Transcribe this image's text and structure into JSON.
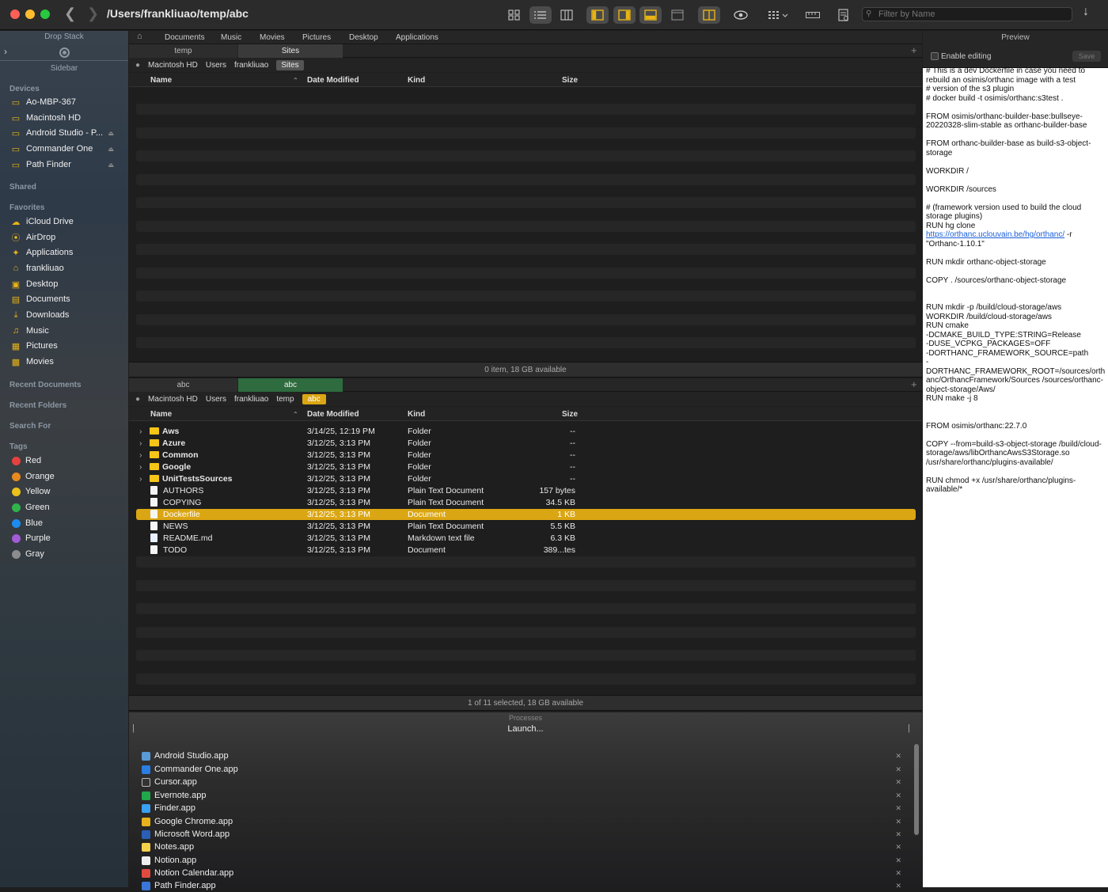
{
  "window": {
    "path": "/Users/frankliuao/temp/abc",
    "filter_placeholder": "Filter by Name"
  },
  "sidebar": {
    "drop_stack": "Drop Stack",
    "sidebar_label": "Sidebar",
    "devices_heading": "Devices",
    "devices": [
      "Ao-MBP-367",
      "Macintosh HD",
      "Android Studio - P...",
      "Commander One",
      "Path Finder"
    ],
    "shared_heading": "Shared",
    "favorites_heading": "Favorites",
    "favorites": [
      "iCloud Drive",
      "AirDrop",
      "Applications",
      "frankliuao",
      "Desktop",
      "Documents",
      "Downloads",
      "Music",
      "Pictures",
      "Movies"
    ],
    "recent_docs": "Recent Documents",
    "recent_folders": "Recent Folders",
    "search_for": "Search For",
    "tags_heading": "Tags",
    "tags": [
      {
        "name": "Red",
        "color": "#e5413e"
      },
      {
        "name": "Orange",
        "color": "#e88a1e"
      },
      {
        "name": "Yellow",
        "color": "#e9c21c"
      },
      {
        "name": "Green",
        "color": "#2fb34a"
      },
      {
        "name": "Blue",
        "color": "#1d8bf0"
      },
      {
        "name": "Purple",
        "color": "#a35bd6"
      },
      {
        "name": "Gray",
        "color": "#8c8c8c"
      }
    ]
  },
  "favbar": [
    "Documents",
    "Music",
    "Movies",
    "Pictures",
    "Desktop",
    "Applications"
  ],
  "top_pane": {
    "tabs": [
      "temp",
      "Sites"
    ],
    "crumbs": [
      "Macintosh HD",
      "Users",
      "frankliuao",
      "Sites"
    ],
    "columns": [
      "Name",
      "Date Modified",
      "Kind",
      "Size"
    ],
    "status": "0 item, 18 GB available"
  },
  "bottom_pane": {
    "tabs": [
      "abc",
      "abc"
    ],
    "crumbs": [
      "Macintosh HD",
      "Users",
      "frankliuao",
      "temp",
      "abc"
    ],
    "columns": [
      "Name",
      "Date Modified",
      "Kind",
      "Size"
    ],
    "rows": [
      {
        "name": "Aws",
        "date": "3/14/25, 12:19 PM",
        "kind": "Folder",
        "size": "--",
        "type": "folder"
      },
      {
        "name": "Azure",
        "date": "3/12/25, 3:13 PM",
        "kind": "Folder",
        "size": "--",
        "type": "folder"
      },
      {
        "name": "Common",
        "date": "3/12/25, 3:13 PM",
        "kind": "Folder",
        "size": "--",
        "type": "folder"
      },
      {
        "name": "Google",
        "date": "3/12/25, 3:13 PM",
        "kind": "Folder",
        "size": "--",
        "type": "folder"
      },
      {
        "name": "UnitTestsSources",
        "date": "3/12/25, 3:13 PM",
        "kind": "Folder",
        "size": "--",
        "type": "folder"
      },
      {
        "name": "AUTHORS",
        "date": "3/12/25, 3:13 PM",
        "kind": "Plain Text Document",
        "size": "157 bytes",
        "type": "doc"
      },
      {
        "name": "COPYING",
        "date": "3/12/25, 3:13 PM",
        "kind": "Plain Text Document",
        "size": "34.5 KB",
        "type": "doc"
      },
      {
        "name": "Dockerfile",
        "date": "3/12/25, 3:13 PM",
        "kind": "Document",
        "size": "1 KB",
        "type": "doc",
        "selected": true
      },
      {
        "name": "NEWS",
        "date": "3/12/25, 3:13 PM",
        "kind": "Plain Text Document",
        "size": "5.5 KB",
        "type": "doc"
      },
      {
        "name": "README.md",
        "date": "3/12/25, 3:13 PM",
        "kind": "Markdown text file",
        "size": "6.3 KB",
        "type": "doc"
      },
      {
        "name": "TODO",
        "date": "3/12/25, 3:13 PM",
        "kind": "Document",
        "size": "389...tes",
        "type": "doc"
      }
    ],
    "status": "1 of 11 selected, 18 GB available"
  },
  "processes": {
    "title": "Processes",
    "launch": "Launch...",
    "apps": [
      {
        "name": "Android Studio.app",
        "color": "#5a9bd5"
      },
      {
        "name": "Commander One.app",
        "color": "#2a7de1"
      },
      {
        "name": "Cursor.app",
        "color": "#333333"
      },
      {
        "name": "Evernote.app",
        "color": "#20a84b"
      },
      {
        "name": "Finder.app",
        "color": "#3aa0f0"
      },
      {
        "name": "Google Chrome.app",
        "color": "#e8b21c"
      },
      {
        "name": "Microsoft Word.app",
        "color": "#2b5fb5"
      },
      {
        "name": "Notes.app",
        "color": "#f5d04a"
      },
      {
        "name": "Notion.app",
        "color": "#eeeeee"
      },
      {
        "name": "Notion Calendar.app",
        "color": "#e04b3f"
      },
      {
        "name": "Path Finder.app",
        "color": "#3a76d8"
      }
    ]
  },
  "preview": {
    "title": "Preview",
    "enable_editing": "Enable editing",
    "save": "Save",
    "lines": [
      "# This is a dev Dockerfile in case you need to rebuild an osimis/orthanc image with a test\n# version of the s3 plugin\n# docker build -t osimis/orthanc:s3test .\n\nFROM osimis/orthanc-builder-base:bullseye-20220328-slim-stable as orthanc-builder-base\n\nFROM orthanc-builder-base as build-s3-object-storage\n\nWORKDIR /\n\nWORKDIR /sources\n\n# (framework version used to build the cloud storage plugins)\nRUN hg clone ",
      "https://orthanc.uclouvain.be/hg/orthanc/",
      " -r \"Orthanc-1.10.1\"\n\nRUN mkdir orthanc-object-storage\n\nCOPY . /sources/orthanc-object-storage\n\n\nRUN mkdir -p /build/cloud-storage/aws\nWORKDIR /build/cloud-storage/aws\nRUN cmake\n-DCMAKE_BUILD_TYPE:STRING=Release\n-DUSE_VCPKG_PACKAGES=OFF\n-DORTHANC_FRAMEWORK_SOURCE=path\n-DORTHANC_FRAMEWORK_ROOT=/sources/orthanc/OrthancFramework/Sources /sources/orthanc-object-storage/Aws/\nRUN make -j 8\n\n\nFROM osimis/orthanc:22.7.0\n\nCOPY --from=build-s3-object-storage /build/cloud-storage/aws/libOrthancAwsS3Storage.so /usr/share/orthanc/plugins-available/\n\nRUN chmod +x /usr/share/orthanc/plugins-available/*"
    ]
  }
}
